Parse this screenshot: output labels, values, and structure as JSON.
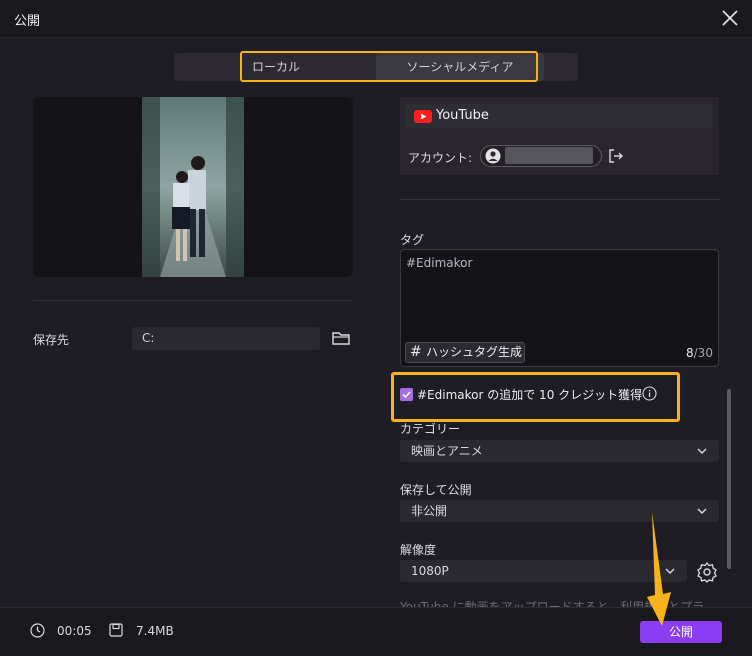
{
  "window": {
    "title": "公開"
  },
  "tabs": [
    {
      "label": "ローカル",
      "active": false
    },
    {
      "label": "ソーシャルメディア",
      "active": true
    }
  ],
  "save": {
    "label": "保存先",
    "path": "C:"
  },
  "platform": {
    "name": "YouTube",
    "account_label": "アカウント:"
  },
  "tags": {
    "label": "タグ",
    "value": "#Edimakor",
    "hashtag_button": "ハッシュタグ生成",
    "count": "8",
    "max": "/30"
  },
  "credit": {
    "text": "#Edimakor の追加で 10 クレジット獲得",
    "checked": true
  },
  "category": {
    "label": "カテゴリー",
    "value": "映画とアニメ"
  },
  "visibility": {
    "label": "保存して公開",
    "value": "非公開"
  },
  "resolution": {
    "label": "解像度",
    "value": "1080P"
  },
  "note": "YouTube に動画をアップロードすると、利用規約とプラ",
  "footer": {
    "duration": "00:05",
    "size": "7.4MB",
    "publish_label": "公開"
  },
  "colors": {
    "accent": "#8b3df2",
    "highlight": "#f6b41a",
    "background": "#1f1d24"
  }
}
